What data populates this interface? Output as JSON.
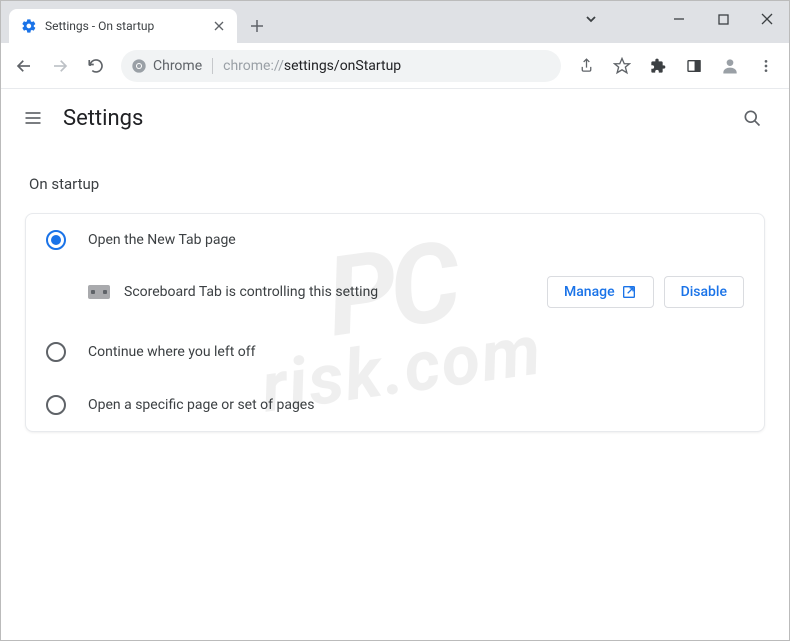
{
  "window": {
    "tab_title": "Settings - On startup"
  },
  "address_bar": {
    "chip_label": "Chrome",
    "url_muted": "chrome://",
    "url_bold": "settings",
    "url_tail": "/onStartup"
  },
  "header": {
    "title": "Settings"
  },
  "section": {
    "title": "On startup",
    "options": [
      {
        "label": "Open the New Tab page"
      },
      {
        "label": "Continue where you left off"
      },
      {
        "label": "Open a specific page or set of pages"
      }
    ],
    "controlled": {
      "text": "Scoreboard Tab is controlling this setting",
      "manage": "Manage",
      "disable": "Disable"
    }
  },
  "watermark": {
    "line1": "PC",
    "line2": "risk.com"
  }
}
